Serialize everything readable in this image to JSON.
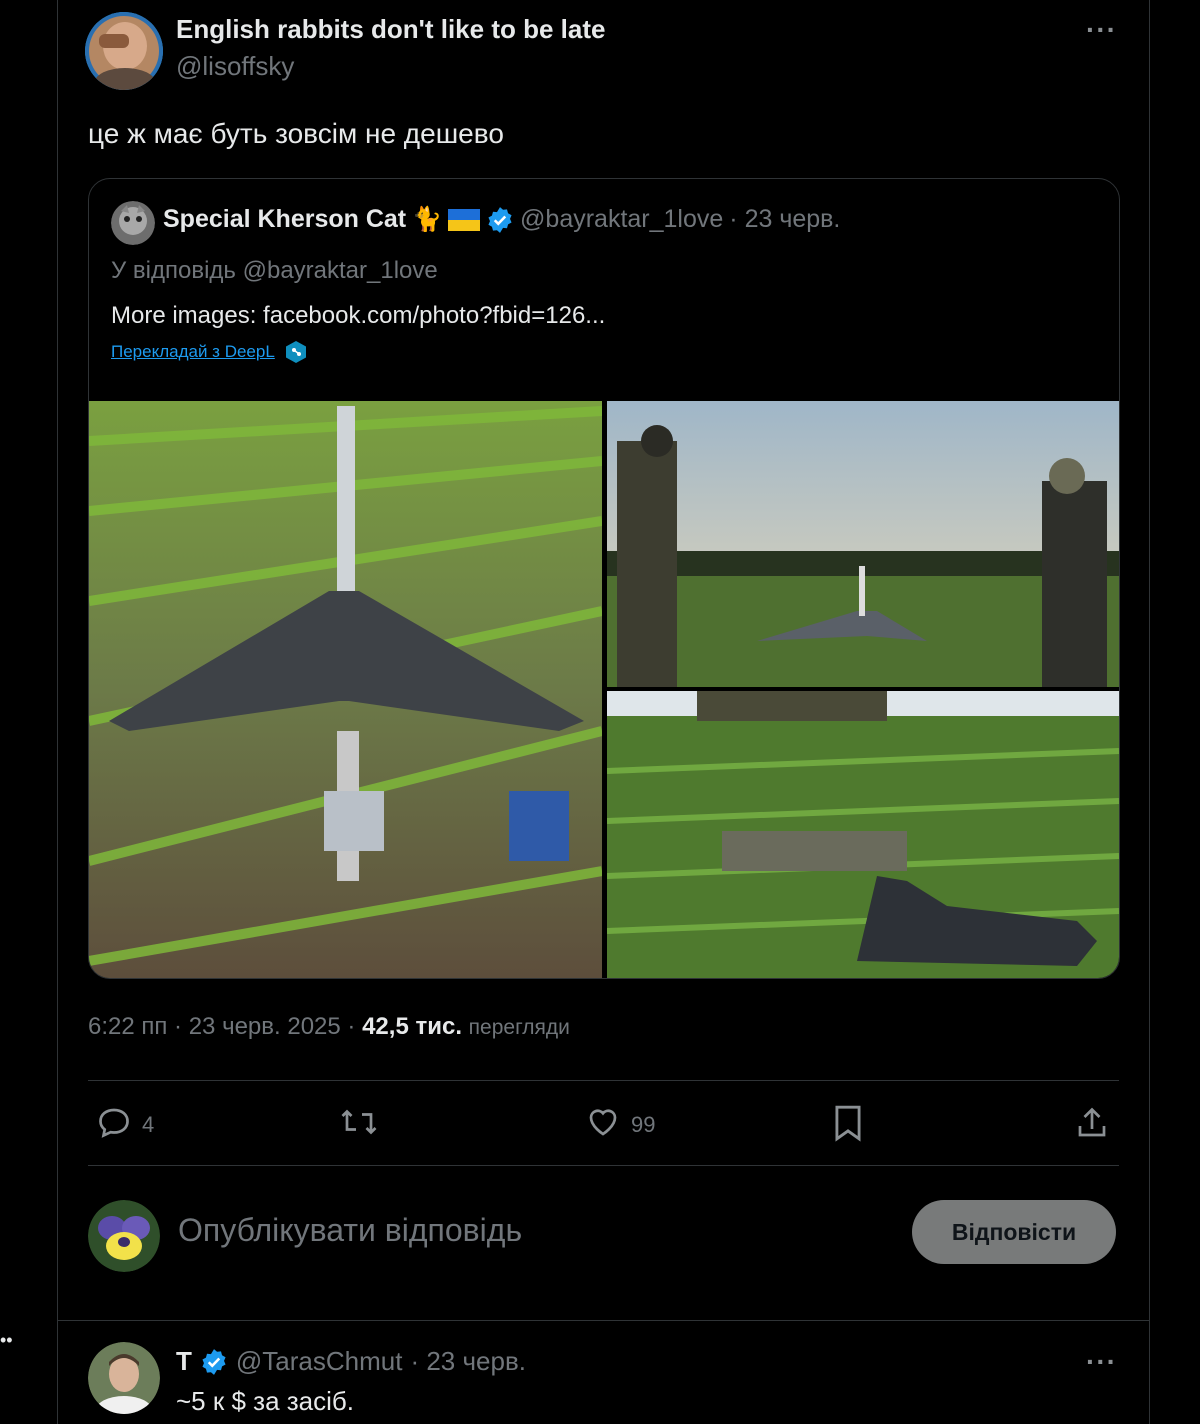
{
  "tweet": {
    "author_name": "English rabbits don't like to be late",
    "author_handle": "@lisoffsky",
    "text": "це ж має буть зовсім не дешево",
    "more_label": "···"
  },
  "quote": {
    "author_name": "Special Kherson Cat",
    "author_emoji": "🐈",
    "author_handle": "@bayraktar_1love",
    "date": "· 23 черв.",
    "reply_to": "У відповідь @bayraktar_1love",
    "text": "More images: facebook.com/photo?fbid=126...",
    "translate": "Перекладай з DeepL"
  },
  "meta": {
    "time": "6:22 пп",
    "date": "· 23 черв. 2025 ·",
    "views_count": "42,5 тис.",
    "views_label": "перегляди"
  },
  "actions": {
    "replies": "4",
    "likes": "99",
    "retweets": "",
    "bookmark": "",
    "share": ""
  },
  "composer": {
    "placeholder": "Опублікувати відповідь",
    "button": "Відповісти"
  },
  "reply_tweet": {
    "author_name": "T",
    "author_handle": "@TarasChmut",
    "date": "· 23 черв.",
    "text": "~5 к $ за засіб.",
    "more_label": "···"
  },
  "left_dots": "••",
  "colors": {
    "background": "#000000",
    "border": "#2f3336",
    "muted": "#71767b",
    "text": "#e7e9ea",
    "accent": "#1d9bf0",
    "reply_button": "#787a7a"
  }
}
